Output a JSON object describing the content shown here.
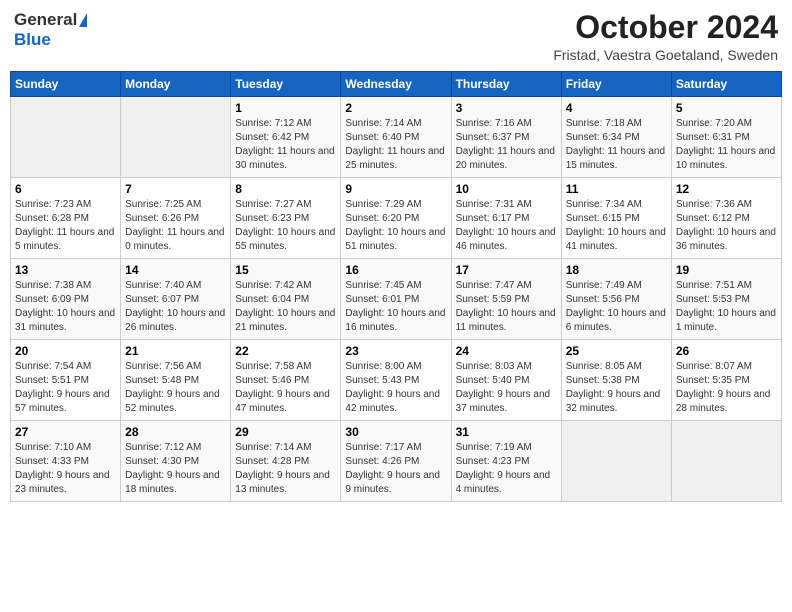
{
  "header": {
    "logo_general": "General",
    "logo_blue": "Blue",
    "month_title": "October 2024",
    "location": "Fristad, Vaestra Goetaland, Sweden"
  },
  "weekdays": [
    "Sunday",
    "Monday",
    "Tuesday",
    "Wednesday",
    "Thursday",
    "Friday",
    "Saturday"
  ],
  "weeks": [
    [
      {
        "day": "",
        "sunrise": "",
        "sunset": "",
        "daylight": ""
      },
      {
        "day": "",
        "sunrise": "",
        "sunset": "",
        "daylight": ""
      },
      {
        "day": "1",
        "sunrise": "Sunrise: 7:12 AM",
        "sunset": "Sunset: 6:42 PM",
        "daylight": "Daylight: 11 hours and 30 minutes."
      },
      {
        "day": "2",
        "sunrise": "Sunrise: 7:14 AM",
        "sunset": "Sunset: 6:40 PM",
        "daylight": "Daylight: 11 hours and 25 minutes."
      },
      {
        "day": "3",
        "sunrise": "Sunrise: 7:16 AM",
        "sunset": "Sunset: 6:37 PM",
        "daylight": "Daylight: 11 hours and 20 minutes."
      },
      {
        "day": "4",
        "sunrise": "Sunrise: 7:18 AM",
        "sunset": "Sunset: 6:34 PM",
        "daylight": "Daylight: 11 hours and 15 minutes."
      },
      {
        "day": "5",
        "sunrise": "Sunrise: 7:20 AM",
        "sunset": "Sunset: 6:31 PM",
        "daylight": "Daylight: 11 hours and 10 minutes."
      }
    ],
    [
      {
        "day": "6",
        "sunrise": "Sunrise: 7:23 AM",
        "sunset": "Sunset: 6:28 PM",
        "daylight": "Daylight: 11 hours and 5 minutes."
      },
      {
        "day": "7",
        "sunrise": "Sunrise: 7:25 AM",
        "sunset": "Sunset: 6:26 PM",
        "daylight": "Daylight: 11 hours and 0 minutes."
      },
      {
        "day": "8",
        "sunrise": "Sunrise: 7:27 AM",
        "sunset": "Sunset: 6:23 PM",
        "daylight": "Daylight: 10 hours and 55 minutes."
      },
      {
        "day": "9",
        "sunrise": "Sunrise: 7:29 AM",
        "sunset": "Sunset: 6:20 PM",
        "daylight": "Daylight: 10 hours and 51 minutes."
      },
      {
        "day": "10",
        "sunrise": "Sunrise: 7:31 AM",
        "sunset": "Sunset: 6:17 PM",
        "daylight": "Daylight: 10 hours and 46 minutes."
      },
      {
        "day": "11",
        "sunrise": "Sunrise: 7:34 AM",
        "sunset": "Sunset: 6:15 PM",
        "daylight": "Daylight: 10 hours and 41 minutes."
      },
      {
        "day": "12",
        "sunrise": "Sunrise: 7:36 AM",
        "sunset": "Sunset: 6:12 PM",
        "daylight": "Daylight: 10 hours and 36 minutes."
      }
    ],
    [
      {
        "day": "13",
        "sunrise": "Sunrise: 7:38 AM",
        "sunset": "Sunset: 6:09 PM",
        "daylight": "Daylight: 10 hours and 31 minutes."
      },
      {
        "day": "14",
        "sunrise": "Sunrise: 7:40 AM",
        "sunset": "Sunset: 6:07 PM",
        "daylight": "Daylight: 10 hours and 26 minutes."
      },
      {
        "day": "15",
        "sunrise": "Sunrise: 7:42 AM",
        "sunset": "Sunset: 6:04 PM",
        "daylight": "Daylight: 10 hours and 21 minutes."
      },
      {
        "day": "16",
        "sunrise": "Sunrise: 7:45 AM",
        "sunset": "Sunset: 6:01 PM",
        "daylight": "Daylight: 10 hours and 16 minutes."
      },
      {
        "day": "17",
        "sunrise": "Sunrise: 7:47 AM",
        "sunset": "Sunset: 5:59 PM",
        "daylight": "Daylight: 10 hours and 11 minutes."
      },
      {
        "day": "18",
        "sunrise": "Sunrise: 7:49 AM",
        "sunset": "Sunset: 5:56 PM",
        "daylight": "Daylight: 10 hours and 6 minutes."
      },
      {
        "day": "19",
        "sunrise": "Sunrise: 7:51 AM",
        "sunset": "Sunset: 5:53 PM",
        "daylight": "Daylight: 10 hours and 1 minute."
      }
    ],
    [
      {
        "day": "20",
        "sunrise": "Sunrise: 7:54 AM",
        "sunset": "Sunset: 5:51 PM",
        "daylight": "Daylight: 9 hours and 57 minutes."
      },
      {
        "day": "21",
        "sunrise": "Sunrise: 7:56 AM",
        "sunset": "Sunset: 5:48 PM",
        "daylight": "Daylight: 9 hours and 52 minutes."
      },
      {
        "day": "22",
        "sunrise": "Sunrise: 7:58 AM",
        "sunset": "Sunset: 5:46 PM",
        "daylight": "Daylight: 9 hours and 47 minutes."
      },
      {
        "day": "23",
        "sunrise": "Sunrise: 8:00 AM",
        "sunset": "Sunset: 5:43 PM",
        "daylight": "Daylight: 9 hours and 42 minutes."
      },
      {
        "day": "24",
        "sunrise": "Sunrise: 8:03 AM",
        "sunset": "Sunset: 5:40 PM",
        "daylight": "Daylight: 9 hours and 37 minutes."
      },
      {
        "day": "25",
        "sunrise": "Sunrise: 8:05 AM",
        "sunset": "Sunset: 5:38 PM",
        "daylight": "Daylight: 9 hours and 32 minutes."
      },
      {
        "day": "26",
        "sunrise": "Sunrise: 8:07 AM",
        "sunset": "Sunset: 5:35 PM",
        "daylight": "Daylight: 9 hours and 28 minutes."
      }
    ],
    [
      {
        "day": "27",
        "sunrise": "Sunrise: 7:10 AM",
        "sunset": "Sunset: 4:33 PM",
        "daylight": "Daylight: 9 hours and 23 minutes."
      },
      {
        "day": "28",
        "sunrise": "Sunrise: 7:12 AM",
        "sunset": "Sunset: 4:30 PM",
        "daylight": "Daylight: 9 hours and 18 minutes."
      },
      {
        "day": "29",
        "sunrise": "Sunrise: 7:14 AM",
        "sunset": "Sunset: 4:28 PM",
        "daylight": "Daylight: 9 hours and 13 minutes."
      },
      {
        "day": "30",
        "sunrise": "Sunrise: 7:17 AM",
        "sunset": "Sunset: 4:26 PM",
        "daylight": "Daylight: 9 hours and 9 minutes."
      },
      {
        "day": "31",
        "sunrise": "Sunrise: 7:19 AM",
        "sunset": "Sunset: 4:23 PM",
        "daylight": "Daylight: 9 hours and 4 minutes."
      },
      {
        "day": "",
        "sunrise": "",
        "sunset": "",
        "daylight": ""
      },
      {
        "day": "",
        "sunrise": "",
        "sunset": "",
        "daylight": ""
      }
    ]
  ]
}
